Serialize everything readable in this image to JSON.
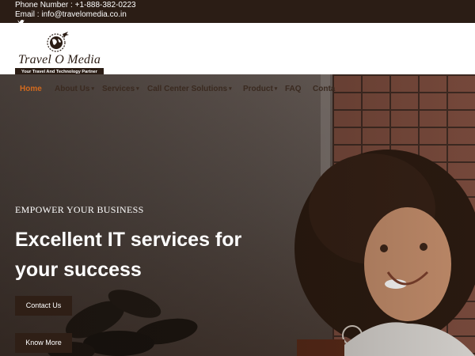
{
  "topbar": {
    "phone_label": "Phone Number :",
    "phone_value": "+1-888-382-0223",
    "email_label": "Email :",
    "email_value": "info@travelomedia.co.in",
    "social_icon": "twitter-icon"
  },
  "logo": {
    "brand": "Travel O Media",
    "tagline": "Your Travel And Technology Partner",
    "icon": "globe-plane-icon"
  },
  "nav": {
    "items": [
      {
        "label": "Home",
        "has_dropdown": false,
        "active": true
      },
      {
        "label": "About Us",
        "has_dropdown": true,
        "active": false
      },
      {
        "label": "Services",
        "has_dropdown": true,
        "active": false
      },
      {
        "label": "Call Center Solutions",
        "has_dropdown": true,
        "active": false
      },
      {
        "label": "Product",
        "has_dropdown": true,
        "active": false
      },
      {
        "label": "FAQ",
        "has_dropdown": false,
        "active": false
      },
      {
        "label": "Conta",
        "has_dropdown": false,
        "active": false
      }
    ],
    "caret": "▾",
    "active_color": "#d26a1e"
  },
  "hero": {
    "eyebrow": "EMPOWER YOUR BUSINESS",
    "headline_line1": "Excellent IT services for",
    "headline_line2": "your success",
    "contact_button": "Contact Us",
    "more_button": "Know More"
  },
  "colors": {
    "dark_brown": "#2b1d15",
    "accent_orange": "#d26a1e",
    "white": "#ffffff"
  }
}
